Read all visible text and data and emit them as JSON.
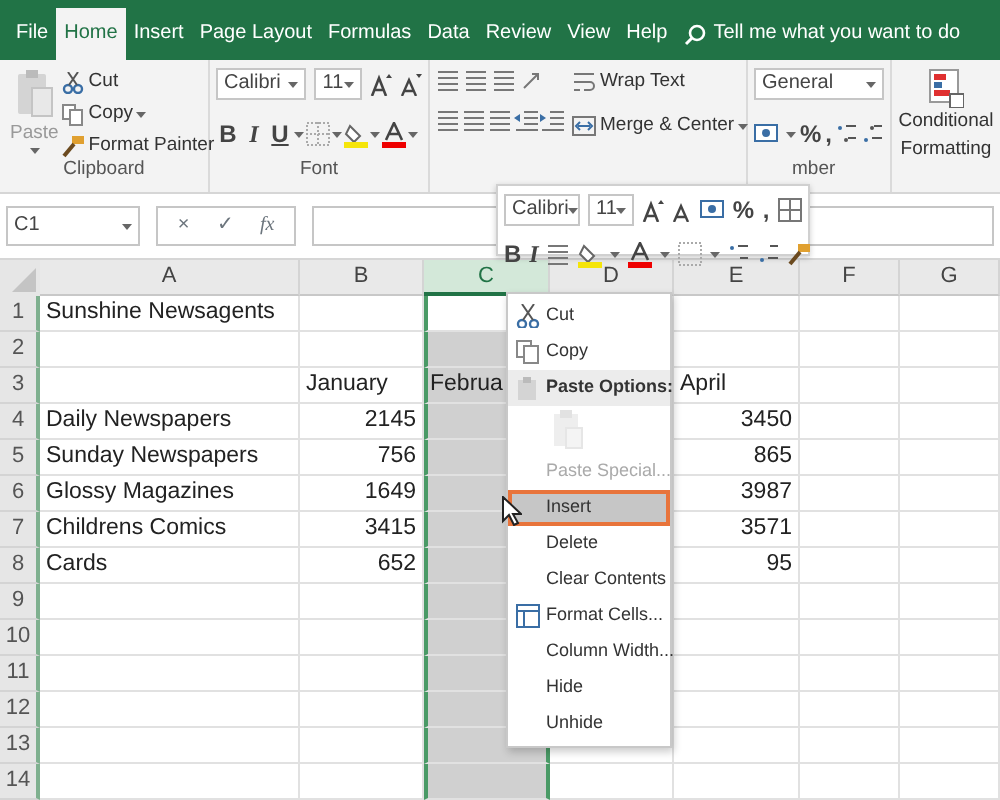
{
  "ribbon_tabs": [
    {
      "label": "File",
      "selected": false
    },
    {
      "label": "Home",
      "selected": true
    },
    {
      "label": "Insert",
      "selected": false
    },
    {
      "label": "Page Layout",
      "selected": false
    },
    {
      "label": "Formulas",
      "selected": false
    },
    {
      "label": "Data",
      "selected": false
    },
    {
      "label": "Review",
      "selected": false
    },
    {
      "label": "View",
      "selected": false
    },
    {
      "label": "Help",
      "selected": false
    }
  ],
  "tell_me": "Tell me what you want to do",
  "clipboard": {
    "paste": "Paste",
    "cut": "Cut",
    "copy": "Copy",
    "format_painter": "Format Painter",
    "label": "Clipboard"
  },
  "font": {
    "name": "Calibri",
    "size": "11",
    "bold": "B",
    "italic": "I",
    "underline": "U",
    "label": "Font"
  },
  "alignment": {
    "wrap_text": "Wrap Text",
    "merge": "Merge & Center"
  },
  "number": {
    "format": "General",
    "percent": "%",
    "comma": ",",
    "label": "mber"
  },
  "styles": {
    "conditional_formatting": "Conditional Formatting"
  },
  "formula_bar": {
    "name_box": "C1",
    "cancel": "×",
    "enter": "✓",
    "function": "fx"
  },
  "columns": [
    {
      "label": "A",
      "selected": false
    },
    {
      "label": "B",
      "selected": false
    },
    {
      "label": "C",
      "selected": true
    },
    {
      "label": "D",
      "selected": false
    },
    {
      "label": "E",
      "selected": false
    },
    {
      "label": "F",
      "selected": false
    },
    {
      "label": "G",
      "selected": false
    }
  ],
  "rows": [
    {
      "number": "1",
      "a": "Sunshine Newsagents"
    },
    {
      "number": "2"
    },
    {
      "number": "3",
      "kind": "text",
      "b": "January",
      "c": "Februa",
      "e": "April"
    },
    {
      "number": "4",
      "kind": "data",
      "a": "Daily Newspapers",
      "b": "2145",
      "e": "3450"
    },
    {
      "number": "5",
      "kind": "data",
      "a": "Sunday Newspapers",
      "b": "756",
      "e": "865"
    },
    {
      "number": "6",
      "kind": "data",
      "a": "Glossy Magazines",
      "b": "1649",
      "e": "3987"
    },
    {
      "number": "7",
      "kind": "data",
      "a": "Childrens Comics",
      "b": "3415",
      "e": "3571"
    },
    {
      "number": "8",
      "kind": "data",
      "a": "Cards",
      "b": "652",
      "e": "95"
    },
    {
      "number": "9"
    },
    {
      "number": "10"
    },
    {
      "number": "11"
    },
    {
      "number": "12"
    },
    {
      "number": "13"
    },
    {
      "number": "14"
    }
  ],
  "mini_toolbar": {
    "font": "Calibri",
    "size": "11",
    "percent": "%",
    "comma": ",",
    "bold": "B",
    "italic": "I"
  },
  "context_menu": [
    {
      "label": "Cut",
      "kind": "cut",
      "disabled": false,
      "selected": false
    },
    {
      "label": "Copy",
      "kind": "copy",
      "disabled": false,
      "selected": false
    },
    {
      "label": "Paste Options:",
      "kind": "header",
      "disabled": false,
      "selected": false
    },
    {
      "kind": "paste",
      "disabled": true,
      "selected": false
    },
    {
      "label": "Paste Special...",
      "kind": "plain",
      "disabled": true,
      "selected": false
    },
    {
      "label": "Insert",
      "kind": "plain",
      "disabled": false,
      "selected": true
    },
    {
      "label": "Delete",
      "kind": "plain",
      "disabled": false,
      "selected": false
    },
    {
      "label": "Clear Contents",
      "kind": "plain",
      "disabled": false,
      "selected": false
    },
    {
      "label": "Format Cells...",
      "kind": "format",
      "disabled": false,
      "selected": false
    },
    {
      "label": "Column Width...",
      "kind": "plain",
      "disabled": false,
      "selected": false
    },
    {
      "label": "Hide",
      "kind": "plain",
      "disabled": false,
      "selected": false
    },
    {
      "label": "Unhide",
      "kind": "plain",
      "disabled": false,
      "selected": false
    }
  ]
}
